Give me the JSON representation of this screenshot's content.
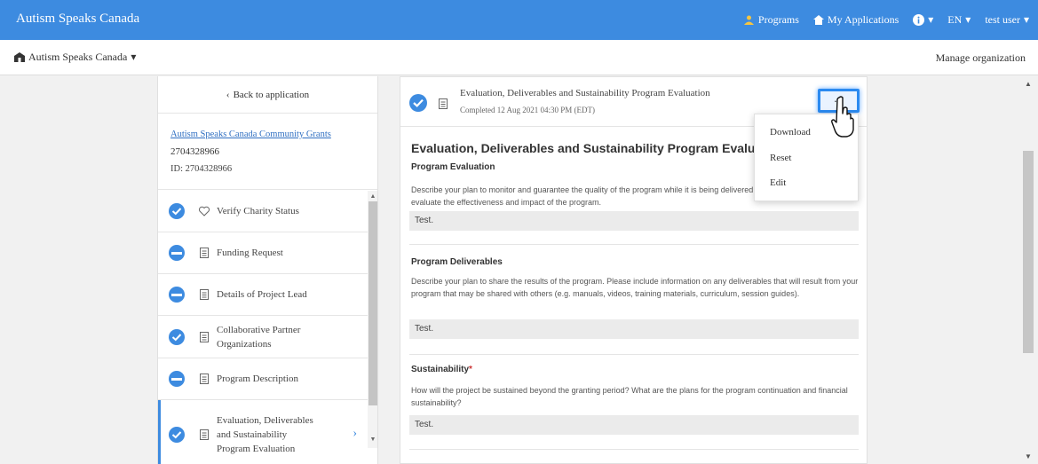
{
  "topbar": {
    "brand": "Autism Speaks Canada",
    "programs": "Programs",
    "my_applications": "My Applications",
    "language": "EN",
    "user": "test user"
  },
  "subheader": {
    "organization": "Autism Speaks Canada",
    "manage": "Manage organization"
  },
  "sidebar": {
    "back": "Back to application",
    "grant_link": "Autism Speaks Canada Community Grants",
    "grant_number": "2704328966",
    "grant_id": "ID: 2704328966",
    "steps": [
      {
        "label": "Verify Charity Status",
        "status": "complete",
        "icon": "heart-icon"
      },
      {
        "label": "Funding Request",
        "status": "in-progress",
        "icon": "doc-icon"
      },
      {
        "label": "Details of Project Lead",
        "status": "in-progress",
        "icon": "doc-icon"
      },
      {
        "label": "Collaborative Partner Organizations",
        "status": "complete",
        "icon": "doc-icon"
      },
      {
        "label": "Program Description",
        "status": "in-progress",
        "icon": "doc-icon"
      },
      {
        "label": "Evaluation, Deliverables and Sustainability Program Evaluation",
        "status": "complete",
        "icon": "doc-icon"
      }
    ]
  },
  "form": {
    "header_title": "Evaluation, Deliverables and Sustainability Program Evaluation",
    "completed": "Completed 12 Aug 2021 04:30 PM (EDT)",
    "more_label": "...",
    "section_title": "Evaluation, Deliverables and Sustainability Program Evaluation",
    "program_evaluation": {
      "heading": "Program Evaluation",
      "description": "Describe your plan to monitor and guarantee the quality of the program while it is being delivered, as well as your plan to evaluate the effectiveness and impact of the program.",
      "answer": "Test."
    },
    "program_deliverables": {
      "heading": "Program Deliverables",
      "description": "Describe your plan to share the results of the program. Please include information on any deliverables that will result from your program that may be shared with others (e.g. manuals, videos, training materials, curriculum, session guides).",
      "answer": "Test."
    },
    "sustainability": {
      "heading": "Sustainability",
      "required_mark": "*",
      "description": "How will the project be sustained beyond the granting period? What are the plans for the program continuation and financial sustainability?",
      "answer": "Test."
    }
  },
  "menu": {
    "download": "Download",
    "reset": "Reset",
    "edit": "Edit"
  },
  "colors": {
    "brand_blue": "#3d8be0",
    "link": "#2f6fc2"
  }
}
